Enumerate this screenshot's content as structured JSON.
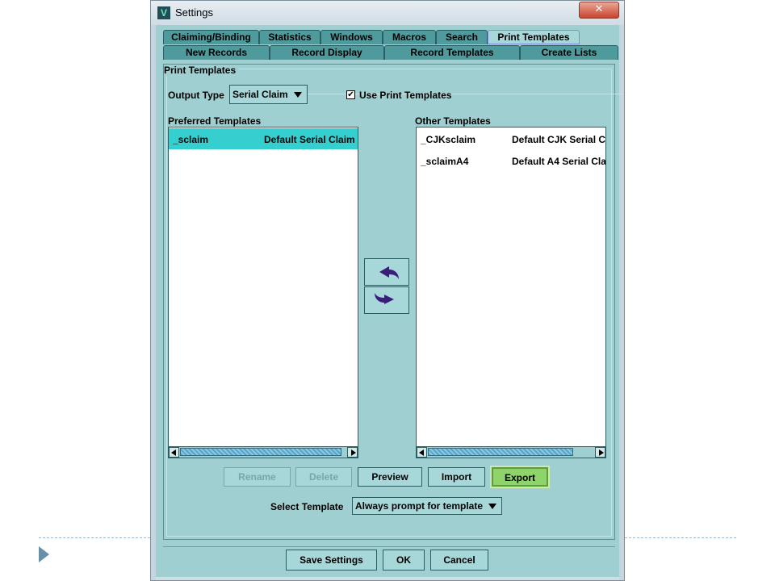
{
  "window": {
    "title": "Settings",
    "close_glyph": "✕",
    "app_icon": "V"
  },
  "tabs": {
    "row1": [
      "Claiming/Binding",
      "Statistics",
      "Windows",
      "Macros",
      "Search",
      "Print Templates"
    ],
    "row2": [
      "New Records",
      "Record Display",
      "Record Templates",
      "Create Lists"
    ],
    "active": "Print Templates"
  },
  "print_templates": {
    "group_label": "Print Templates",
    "output_type_label": "Output Type",
    "output_type_value": "Serial Claim",
    "use_print_templates_label": "Use Print Templates",
    "use_print_templates_checked": true,
    "checkbox_glyph": "✔",
    "preferred_label": "Preferred Templates",
    "preferred": [
      {
        "name": "_sclaim",
        "desc": "Default Serial Claim",
        "selected": true
      }
    ],
    "other_label": "Other Templates",
    "other": [
      {
        "name": "_CJKsclaim",
        "desc": "Default CJK Serial C"
      },
      {
        "name": "_sclaimA4",
        "desc": "Default A4 Serial Cla"
      }
    ],
    "buttons": {
      "rename": "Rename",
      "delete": "Delete",
      "preview": "Preview",
      "import": "Import",
      "export": "Export"
    },
    "select_template_label": "Select Template",
    "select_template_value": "Always prompt for template"
  },
  "footer": {
    "save": "Save Settings",
    "ok": "OK",
    "cancel": "Cancel"
  },
  "colors": {
    "panel": "#9fcfd0",
    "selected_row": "#36cfcf",
    "export_highlight": "#8fd46a",
    "arrow": "#3a1f7a"
  }
}
